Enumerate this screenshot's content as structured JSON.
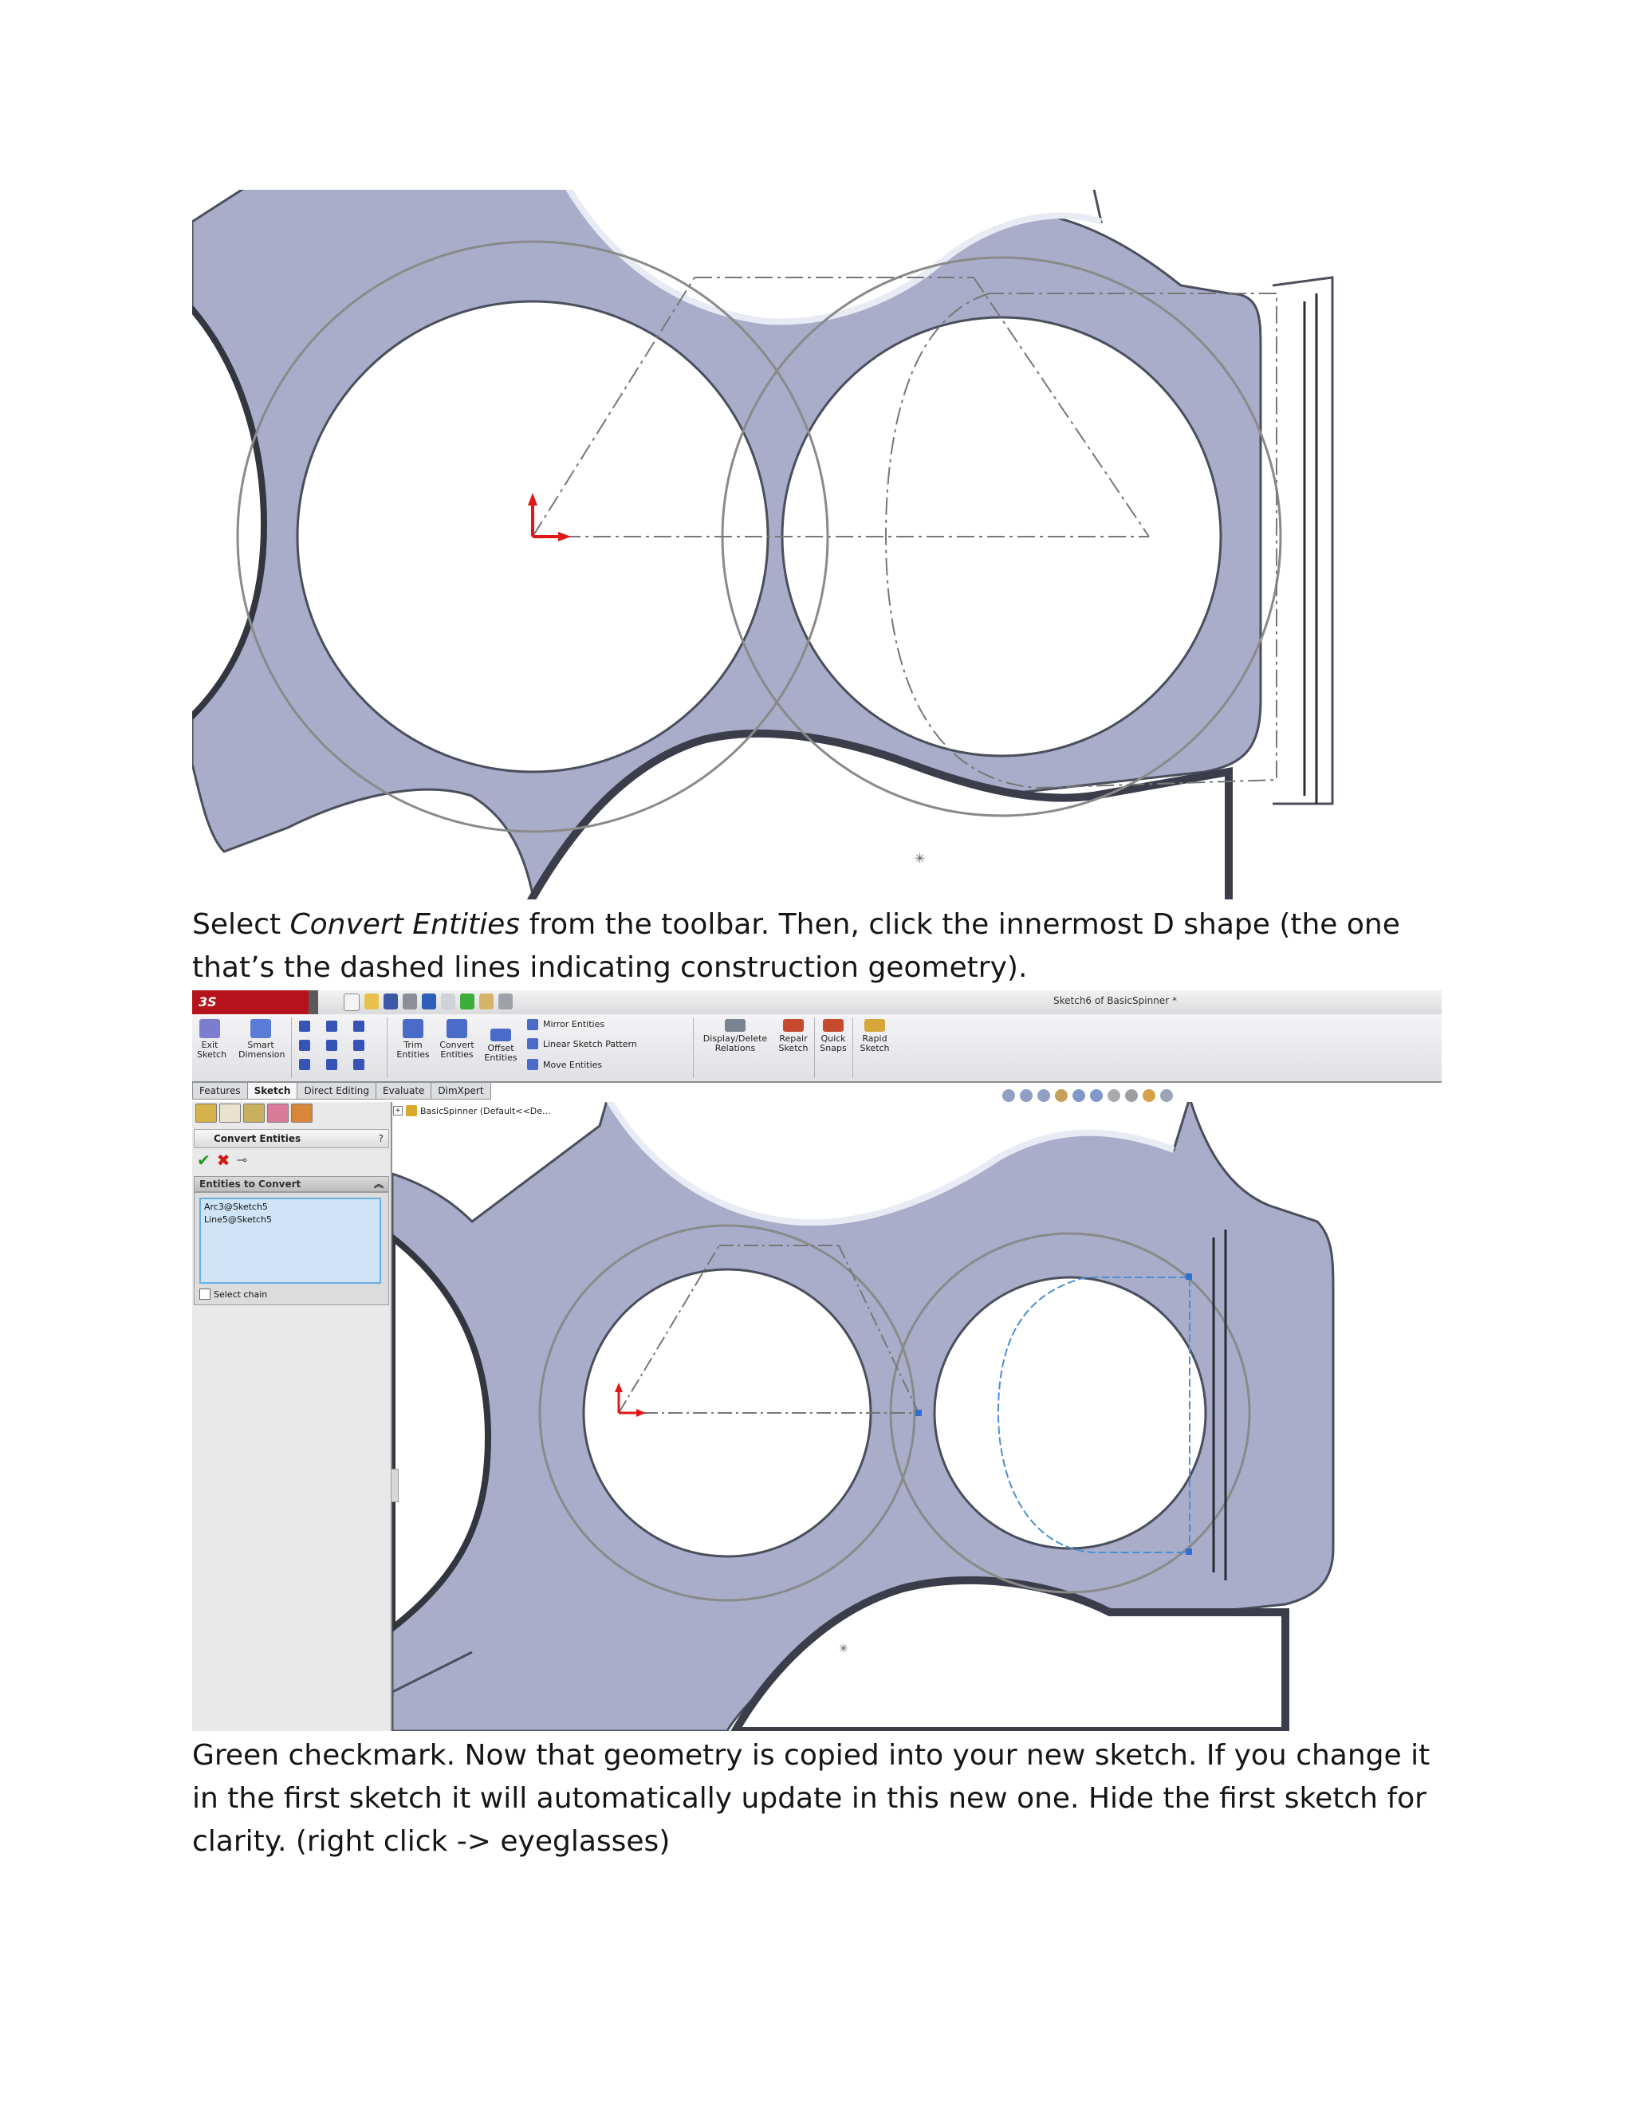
{
  "captions": {
    "caption1_pre": "Select ",
    "caption1_em": "Convert Entities",
    "caption1_post": " from the toolbar. Then, click the innermost D shape (the one that’s the dashed lines indicating construction geometry).",
    "caption2": "Green checkmark. Now that geometry is copied into your new sketch. If you change it in the first sketch it will automatically update in this new one. Hide the first sketch for clarity. (right click -> eyeglasses)"
  },
  "colors": {
    "part_fill": "#a9adc9",
    "part_edge": "#4b4e5c",
    "background": "#ffffff",
    "accent_red": "#b5121b",
    "selection_blue": "#66aee8"
  },
  "solidworks": {
    "logo": "3S SOLIDWORKS",
    "window_title": "Sketch6 of BasicSpinner *",
    "ribbon": {
      "exit_sketch": "Exit Sketch",
      "smart_dimension": "Smart Dimension",
      "trim_entities": "Trim Entities",
      "convert_entities": "Convert Entities",
      "offset_entities": "Offset Entities",
      "mirror_entities": "Mirror Entities",
      "linear_sketch_pattern": "Linear Sketch Pattern",
      "move_entities": "Move Entities",
      "display_delete_relations": "Display/Delete Relations",
      "repair_sketch": "Repair Sketch",
      "quick_snaps": "Quick Snaps",
      "rapid_sketch": "Rapid Sketch"
    },
    "tabs": [
      "Features",
      "Sketch",
      "Direct Editing",
      "Evaluate",
      "DimXpert"
    ],
    "active_tab": "Sketch",
    "feature_tree_root": "BasicSpinner  (Default<<De...",
    "property_manager": {
      "title": "Convert Entities",
      "help": "?",
      "section_title": "Entities to Convert",
      "entities": [
        "Arc3@Sketch5",
        "Line5@Sketch5"
      ],
      "select_chain": "Select chain"
    }
  }
}
